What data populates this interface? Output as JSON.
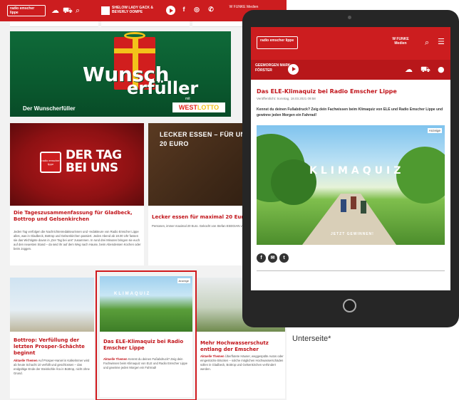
{
  "desktop": {
    "logo": "radio emscher lippe",
    "show_label": "SHELOW LADY GACK & BEVERLY OOMPE",
    "funke": "W FUNKE Medien",
    "banner": {
      "word1": "Wunsch",
      "word2": "erfüller",
      "mit": "mit",
      "lotto": "WEST",
      "lotto2": "LOTTO",
      "caption": "Der Wunscherfüller"
    },
    "cards": [
      {
        "logo_text": "radio emscher lippe",
        "image_text": "DER TAG BEI UNS",
        "title": "Die Tageszusammenfassung für Gladbeck, Bottrop und Gelsenkirchen",
        "text": "Jeden Tag verfolgen die Nachrichtenredakteurinnen und -redakteure von Radio Emscher Lippe alles, was in Gladbeck, Bottrop und Gelsenkirchen passiert. Jeden Abend ab 18.00 Uhr fassen sie das Wichtigste davon in „Der Tag bei uns“ zusammen. In rund drei Minuten bringen sie euch auf den neuesten Stand – da seid ihr auf dem Weg nach Hause, beim Abendessen Kochen oder beim Joggen."
      },
      {
        "image_text": "LECKER ESSEN – FÜR UNTER 20 EURO",
        "title": "Lecker essen für maximal 20 Eur",
        "text": "Personen, immer maximal 20 Euro. Gekocht von Stefan ESEGIAN von Gelsenkirchener Restaurant."
      },
      {
        "title": "Bottrop: Verfüllung der letzten Prosper-Schächte beginnt",
        "kicker": "Aktuelle Themen",
        "text": "Auf Prosper-Haniel in Kalkelmmer wird ab heute Schacht 10 verfüllt und geschlossen – das endgültige Ende der Steinkohle-Ära in Bottrop, nicht ohne Grund."
      },
      {
        "ad": "Anzeige",
        "image_text": "KLIMAQUIZ",
        "title": "Das ELE-Klimaquiz bei Radio Emscher Lippe",
        "kicker": "Aktuelle Themen",
        "text": "Kennst du deinen Fußabdruck? Zeig dein Fachwissen beim Klimaquiz von ELE und Radio Emscher Lippe und gewinne jeden Morgen ein Fahrrad!"
      },
      {
        "title": "Mehr Hochwasserschutz entlang der Emscher",
        "kicker": "Aktuelle Themen",
        "text": "Überflutete Häuser, weggespülte Autos oder eingestürzte Brücken – solche möglichen Hochwasserschäden sollen in Gladbeck, Bottrop und Gelsenkirchen verhindert werden."
      }
    ]
  },
  "tablet": {
    "logo": "radio emscher lippe",
    "funke": "W FUNKE Medien",
    "show_label": "GEEMORGEN MARK FÖRSTER",
    "article_title": "Das ELE-Klimaquiz bei Radio Emscher Lippe",
    "date": "Veröffentlicht: Sonntag, 18.03.2021 09:58",
    "lead": "Kennst du deinen Fußabdruck? Zeig dein Fachwissen beim Klimaquiz von ELE und Radio Emscher Lippe und gewinne jeden Morgen ein Fahrrad!",
    "ad": "Anzeige",
    "image_text": "KLIMAQUIZ",
    "image_sub": "JETZT GEWINNEN!"
  },
  "caption": "Unterseite*"
}
